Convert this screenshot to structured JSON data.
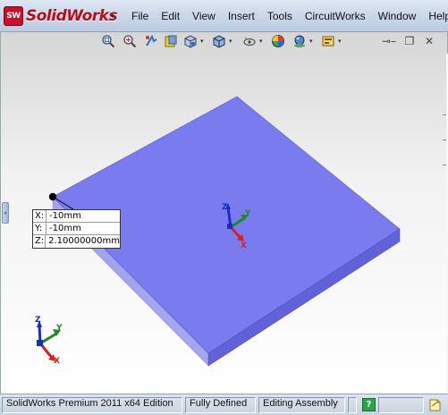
{
  "app": {
    "logo_badge": "SW",
    "logo_text": "SolidWorks",
    "menu_arrow": "▸"
  },
  "menu": {
    "items": [
      "File",
      "Edit",
      "View",
      "Insert",
      "Tools",
      "CircuitWorks",
      "Window",
      "Help"
    ]
  },
  "view_toolbar": {
    "icons": [
      "zoom-to-fit-icon",
      "zoom-to-area-icon",
      "previous-view-icon",
      "section-view-icon",
      "view-orientation-icon",
      "display-style-icon",
      "hide-show-items-icon",
      "edit-appearance-icon",
      "apply-scene-icon",
      "view-settings-icon"
    ]
  },
  "window_controls": {
    "pin": "⊸",
    "minimize": "–",
    "restore": "❐",
    "close": "✕"
  },
  "tooltip": {
    "rows": [
      {
        "label": "X:",
        "value": "-10mm"
      },
      {
        "label": "Y:",
        "value": "-10mm"
      },
      {
        "label": "Z:",
        "value": "2.10000000mm"
      }
    ]
  },
  "triad": {
    "x_label": "X",
    "y_label": "Y",
    "z_label": "Z"
  },
  "statusbar": {
    "edition": "SolidWorks Premium 2011 x64 Edition",
    "sketch_state": "Fully Defined",
    "edit_mode": "Editing Assembly",
    "help_icon": "?"
  },
  "colors": {
    "plate_top": "#7b7bf0",
    "plate_front": "#6262d8",
    "plate_side": "#5858c8",
    "axis_x": "#d42020",
    "axis_y": "#1f8a2a",
    "axis_z": "#1a2fb8"
  }
}
